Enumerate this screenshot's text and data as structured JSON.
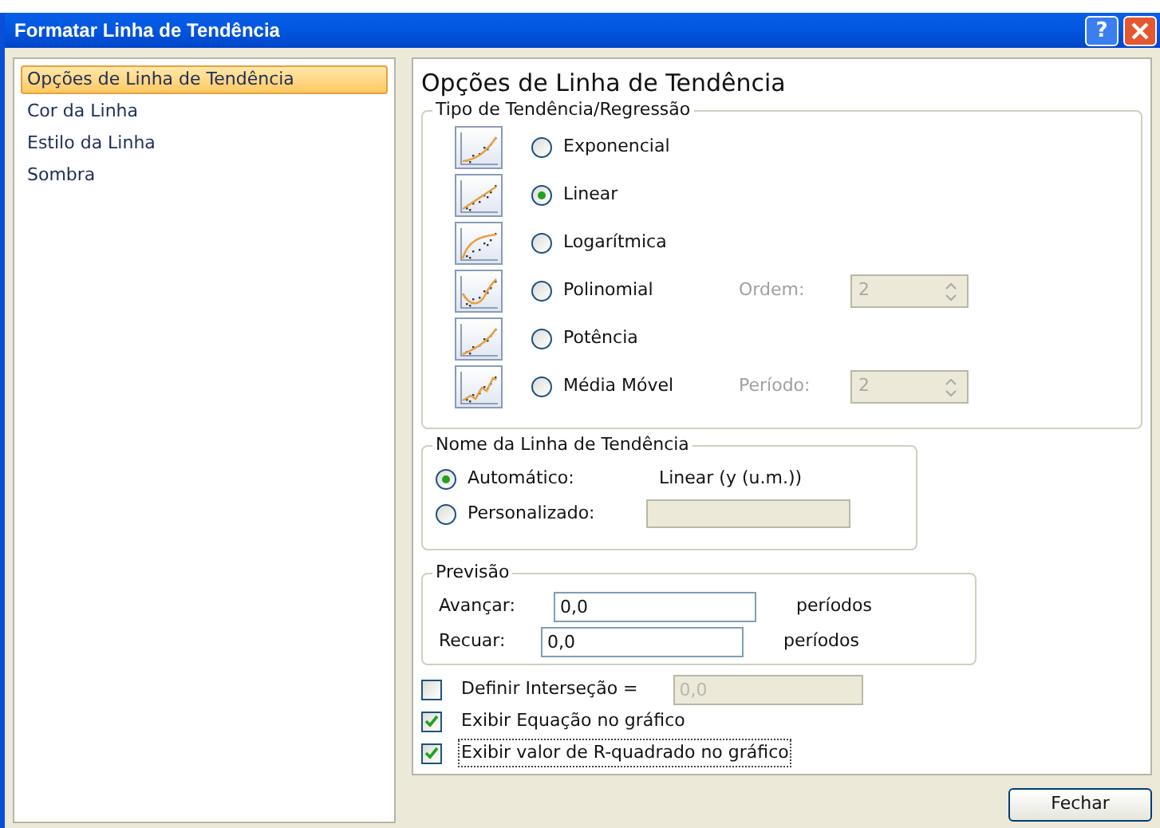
{
  "window": {
    "title": "Formatar Linha de Tendência",
    "help_button": "?"
  },
  "sidebar": {
    "items": [
      {
        "label": "Opções de Linha de Tendência",
        "selected": true
      },
      {
        "label": "Cor da Linha",
        "selected": false
      },
      {
        "label": "Estilo da Linha",
        "selected": false
      },
      {
        "label": "Sombra",
        "selected": false
      }
    ]
  },
  "panel": {
    "heading": "Opções de Linha de Tendência",
    "trend_type": {
      "legend": "Tipo de Tendência/Regressão",
      "options": [
        {
          "kind": "exponential",
          "label": "Exponencial",
          "selected": false
        },
        {
          "kind": "linear",
          "label": "Linear",
          "selected": true
        },
        {
          "kind": "logarithmic",
          "label": "Logarítmica",
          "selected": false
        },
        {
          "kind": "polynomial",
          "label": "Polinomial",
          "selected": false,
          "param": {
            "label": "Ordem:",
            "value": "2",
            "disabled": true
          }
        },
        {
          "kind": "power",
          "label": "Potência",
          "selected": false
        },
        {
          "kind": "moving_average",
          "label": "Média Móvel",
          "selected": false,
          "param": {
            "label": "Período:",
            "value": "2",
            "disabled": true
          }
        }
      ]
    },
    "name": {
      "legend": "Nome da Linha de Tendência",
      "options": [
        {
          "label": "Automático:",
          "selected": true,
          "value": "Linear (y (u.m.))"
        },
        {
          "label": "Personalizado:",
          "selected": false,
          "field_disabled": true
        }
      ]
    },
    "forecast": {
      "legend": "Previsão",
      "rows": [
        {
          "label": "Avançar:",
          "value": "0,0",
          "unit": "períodos"
        },
        {
          "label": "Recuar:",
          "value": "0,0",
          "unit": "períodos"
        }
      ]
    },
    "checks": [
      {
        "label": "Definir Interseção =",
        "checked": false,
        "field": {
          "value": "0,0",
          "disabled": true
        }
      },
      {
        "label": "Exibir Equação no gráfico",
        "checked": true
      },
      {
        "label": "Exibir valor de R-quadrado no gráfico",
        "checked": true,
        "focused": true
      }
    ]
  },
  "buttons": [
    {
      "label": "Fechar"
    }
  ]
}
